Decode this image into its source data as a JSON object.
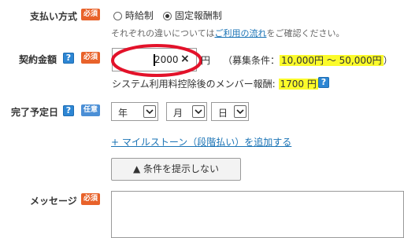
{
  "payment_method": {
    "label": "支払い方式",
    "badge": "必須",
    "options": [
      {
        "label": "時給制",
        "selected": false
      },
      {
        "label": "固定報酬制",
        "selected": true
      }
    ],
    "note_prefix": "それぞれの違いについては",
    "note_link": "ご利用の流れ",
    "note_suffix": "をご確認ください。"
  },
  "contract_amount": {
    "label": "契約金額",
    "help": "?",
    "badge": "必須",
    "value": "2000",
    "clear_icon": "×",
    "unit": "円",
    "condition_prefix": "（募集条件：",
    "condition_range": "10,000円 〜 50,000円",
    "condition_suffix": "）",
    "member_reward_label": "システム利用料控除後のメンバー報酬:",
    "member_reward_value": "1700 円",
    "member_help": "?"
  },
  "due_date": {
    "label": "完了予定日",
    "help": "?",
    "badge": "任意",
    "year_selected": "年",
    "month_selected": "月",
    "day_selected": "日"
  },
  "milestone_link": "+ マイルストーン（段階払い）を追加する",
  "conditions_button": "▲ 条件を提示しない",
  "message": {
    "label": "メッセージ",
    "badge": "必須",
    "value": ""
  },
  "colors": {
    "required_badge": "#e8622a",
    "optional_badge": "#4b8fd6",
    "help_icon": "#2d86d4",
    "highlight": "#fbfb2a",
    "annotation_circle": "#e3122a",
    "link": "#1a73b5"
  },
  "icons": [
    "help-icon",
    "clear-icon",
    "chevron-down-icon",
    "radio-button-icon"
  ]
}
